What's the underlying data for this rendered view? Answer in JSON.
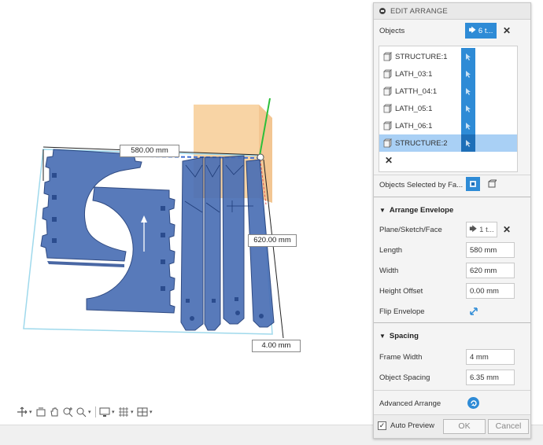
{
  "viewport": {
    "dim_length": "580.00 mm",
    "dim_width": "620.00 mm",
    "dim_offset": "4.00 mm"
  },
  "nav_icons": [
    "orbit-icon",
    "look-at-icon",
    "pan-icon",
    "zoom-icon",
    "zoom-window-icon",
    "display-settings-icon",
    "grid-icon",
    "viewports-icon"
  ],
  "panel": {
    "title": "EDIT ARRANGE",
    "objects_label": "Objects",
    "objects_selected_text": "6 t...",
    "objects": [
      {
        "name": "STRUCTURE:1",
        "selected": false
      },
      {
        "name": "LATH_03:1",
        "selected": false
      },
      {
        "name": "LATTH_04:1",
        "selected": false
      },
      {
        "name": "LATH_05:1",
        "selected": false
      },
      {
        "name": "LATH_06:1",
        "selected": false
      },
      {
        "name": "STRUCTURE:2",
        "selected": true
      }
    ],
    "objects_selected_by_face_label": "Objects Selected by Fa...",
    "arrange_envelope": {
      "title": "Arrange Envelope",
      "plane_label": "Plane/Sketch/Face",
      "plane_value": "1 t...",
      "length_label": "Length",
      "length_value": "580 mm",
      "width_label": "Width",
      "width_value": "620 mm",
      "height_offset_label": "Height Offset",
      "height_offset_value": "0.00 mm",
      "flip_label": "Flip Envelope"
    },
    "spacing": {
      "title": "Spacing",
      "frame_width_label": "Frame Width",
      "frame_width_value": "4 mm",
      "object_spacing_label": "Object Spacing",
      "object_spacing_value": "6.35 mm"
    },
    "advanced_label": "Advanced Arrange",
    "auto_preview_label": "Auto Preview",
    "auto_preview_checked": true,
    "ok_label": "OK",
    "cancel_label": "Cancel"
  },
  "colors": {
    "part_blue": "#4a6fb5",
    "part_stroke": "#1f3c78",
    "accent_blue": "#2e8bd6",
    "selected_row": "#a9d0f5",
    "envelope_line": "#8fd3e8",
    "orange_box": "#f6c98d"
  }
}
